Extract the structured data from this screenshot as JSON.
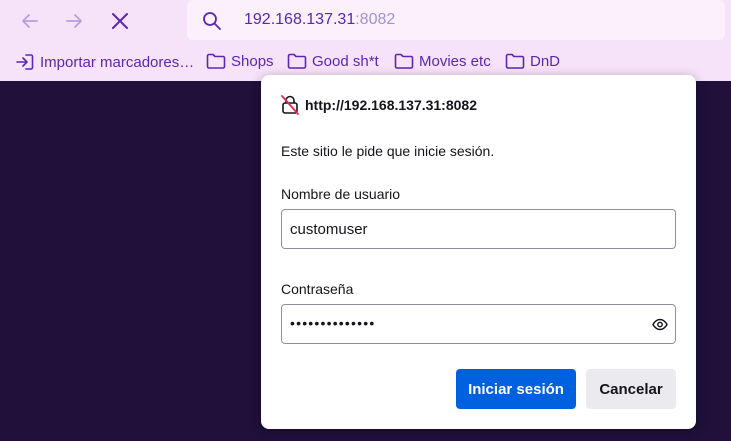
{
  "toolbar": {
    "back_icon": "arrow-left-icon",
    "forward_icon": "arrow-right-icon",
    "stop_icon": "close-icon",
    "url_host": "192.168.137.31",
    "url_port": ":8082"
  },
  "bookmarks": {
    "import_label": "Importar marcadores…",
    "items": [
      {
        "label": "Shops"
      },
      {
        "label": "Good sh*t"
      },
      {
        "label": "Movies etc"
      },
      {
        "label": "DnD"
      }
    ]
  },
  "dialog": {
    "origin": "http://192.168.137.31:8082",
    "message": "Este sitio le pide que inicie sesión.",
    "username_label": "Nombre de usuario",
    "username_value": "customuser",
    "password_label": "Contraseña",
    "password_masked": "••••••••••••••",
    "login_button": "Iniciar sesión",
    "cancel_button": "Cancelar"
  },
  "colors": {
    "toolbar_bg": "#f7e3f9",
    "accent": "#5a26b2",
    "page_bg": "#20103a",
    "primary_button": "#0061e0"
  }
}
